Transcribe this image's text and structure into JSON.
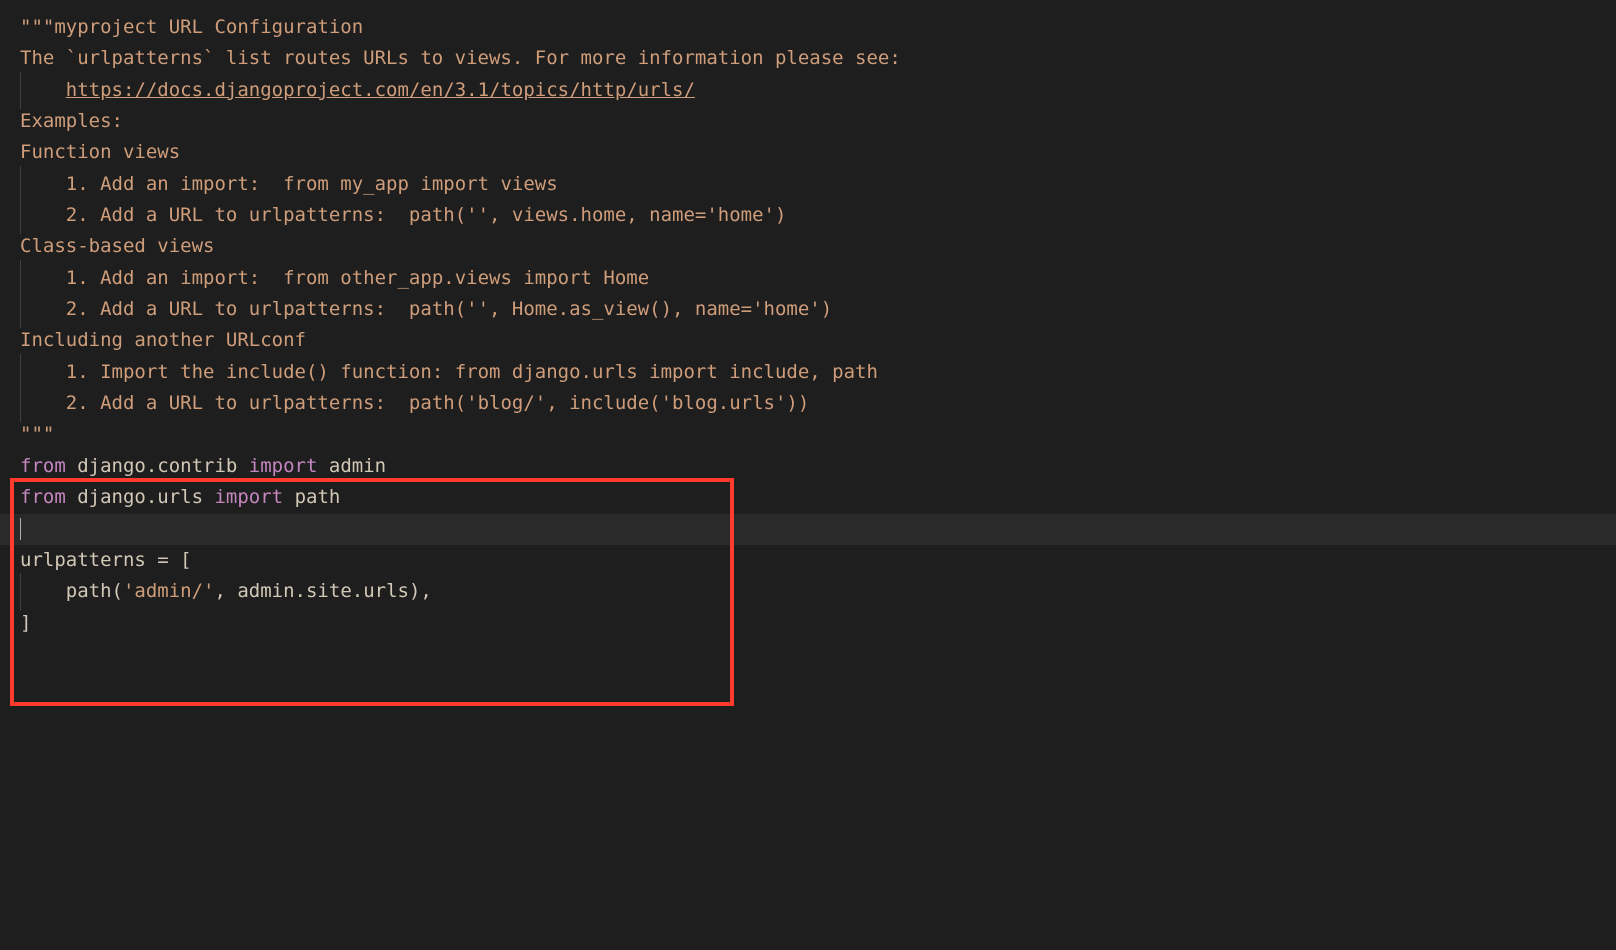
{
  "lines": {
    "l1": "\"\"\"myproject URL Configuration",
    "l2": "",
    "l3": "The `urlpatterns` list routes URLs to views. For more information please see:",
    "l4_indent": "    ",
    "l4_url": "https://docs.djangoproject.com/en/3.1/topics/http/urls/",
    "l5": "Examples:",
    "l6": "Function views",
    "l7_indent": "    ",
    "l7": "1. Add an import:  from my_app import views",
    "l8_indent": "    ",
    "l8": "2. Add a URL to urlpatterns:  path('', views.home, name='home')",
    "l9": "Class-based views",
    "l10_indent": "    ",
    "l10": "1. Add an import:  from other_app.views import Home",
    "l11_indent": "    ",
    "l11": "2. Add a URL to urlpatterns:  path('', Home.as_view(), name='home')",
    "l12": "Including another URLconf",
    "l13_indent": "    ",
    "l13": "1. Import the include() function: from django.urls import include, path",
    "l14_indent": "    ",
    "l14": "2. Add a URL to urlpatterns:  path('blog/', include('blog.urls'))",
    "l15": "\"\"\"",
    "l16_from": "from",
    "l16_mod": " django.contrib ",
    "l16_import": "import",
    "l16_name": " admin",
    "l17_from": "from",
    "l17_mod": " django.urls ",
    "l17_import": "import",
    "l17_name": " path",
    "l18": "",
    "l19": "urlpatterns = [",
    "l20_indent": "    ",
    "l20_a": "path(",
    "l20_str": "'admin/'",
    "l20_b": ", admin.site.urls),",
    "l21": "]"
  }
}
